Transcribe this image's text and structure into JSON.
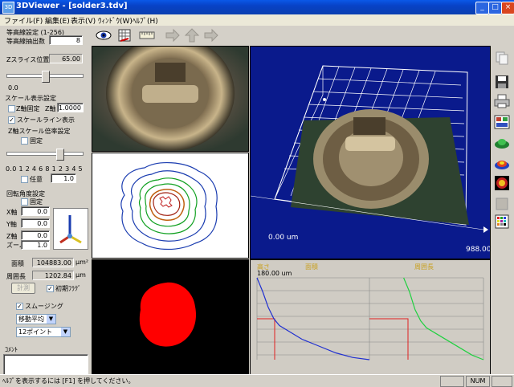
{
  "window": {
    "title": "3DViewer - [solder3.tdv]",
    "app_icon": "3D",
    "minimize": "_",
    "maximize": "□",
    "close": "×"
  },
  "menu": [
    "ファイル(F)",
    "編集(E)",
    "表示(V)",
    "ｳｨﾝﾄﾞｳ(W)",
    "ﾍﾙﾌﾟ(H)"
  ],
  "contour": {
    "group_label": "等高線設定 (1-256)",
    "extract_label": "等高線抽出数",
    "extract_value": "8",
    "z_slice_label": "Zスライス位置",
    "z_slice_value": "65.00",
    "slider_min": "0.0"
  },
  "scale_display": {
    "group_label": "スケール表示設定",
    "z_fixed_label": "Z軸固定",
    "z_axis_label": "Z軸",
    "z_axis_value": "1.0000",
    "scale_line_label": "スケールライン表示",
    "scale_line_checked": "✓"
  },
  "z_scale": {
    "group_label": "Z軸スケール倍率設定",
    "fixed_label": "固定",
    "ticks": "0.0 1 2 4 6 8 1 2 3 4 5",
    "arbitrary_label": "任意",
    "arbitrary_value": "1.0"
  },
  "rotation": {
    "group_label": "回転角度設定",
    "fixed_label": "固定",
    "x_label": "X軸",
    "x_value": "0.0",
    "y_label": "Y軸",
    "y_value": "0.0",
    "z_label": "Z軸",
    "z_value": "0.0",
    "zoom_label": "ズーム",
    "zoom_value": "1.0"
  },
  "measure": {
    "area_label": "面積",
    "area_value": "104883.00",
    "area_unit": "μm²",
    "perimeter_label": "周囲長",
    "perimeter_value": "1202.84",
    "perimeter_unit": "μm",
    "calc_button": "計測",
    "init_flag_label": "初期ﾌﾗｸﾞ",
    "init_flag_checked": "✓"
  },
  "smoothing": {
    "label": "スムージング",
    "checked": "✓",
    "method": "移動平均",
    "points": "12ポイント"
  },
  "comment": {
    "label": "ｺﾒﾝﾄ"
  },
  "view3d": {
    "z_readout": "0.00 um",
    "right_readout": "988.00"
  },
  "graph": {
    "label_left": "高さ",
    "label_area": "面積",
    "label_perimeter": "周囲長",
    "top_value": "180.00 um"
  },
  "status": {
    "message": "ﾍﾙﾌﾟを表示するには [F1] を押してください。",
    "num": "NUM"
  },
  "colors": {
    "title_blue": "#0a4fd8",
    "view_blue": "#0a1a8c",
    "mask_red": "#ff0000",
    "graph_bg": "#d0ccc4"
  },
  "chart_data": [
    {
      "type": "line",
      "title": "面積",
      "ylabel": "高さ",
      "x": [
        0.0,
        0.05,
        0.1,
        0.15,
        0.2,
        0.3,
        0.4,
        0.55,
        0.7,
        0.85,
        1.0
      ],
      "series": [
        {
          "values": [
            180,
            150,
            115,
            90,
            75,
            60,
            45,
            30,
            15,
            5,
            0
          ]
        }
      ],
      "ylim": [
        0,
        180
      ]
    },
    {
      "type": "line",
      "title": "周囲長",
      "ylabel": "高さ",
      "x": [
        0.3,
        0.35,
        0.4,
        0.45,
        0.5,
        0.6,
        0.7,
        0.8,
        0.9,
        1.0
      ],
      "series": [
        {
          "values": [
            180,
            150,
            110,
            85,
            70,
            55,
            40,
            25,
            10,
            0
          ]
        }
      ],
      "ylim": [
        0,
        180
      ]
    }
  ]
}
